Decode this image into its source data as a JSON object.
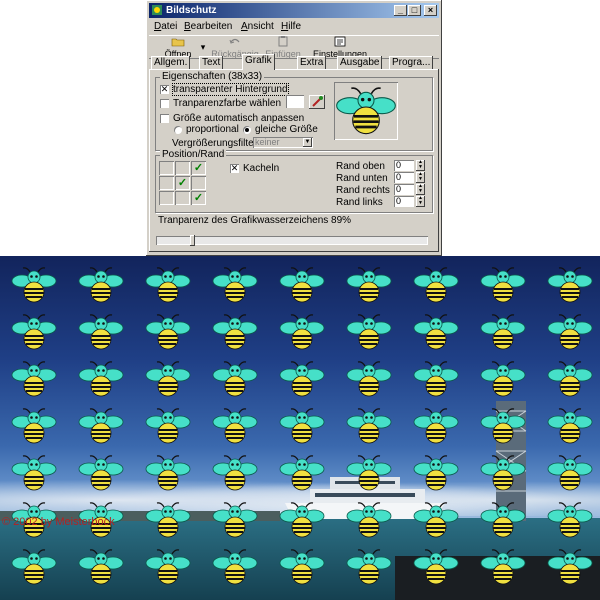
{
  "window": {
    "title": "Bildschutz",
    "min": "_",
    "max": "□",
    "close": "×"
  },
  "menu": [
    "Datei",
    "Bearbeiten",
    "Ansicht",
    "Hilfe"
  ],
  "toolbar": {
    "open": "Öffnen",
    "undo": "Rückgängig",
    "paste": "Einfügen",
    "settings": "Einstellungen"
  },
  "tabs": [
    "Allgem.",
    "Text",
    "Grafik",
    "Extra",
    "Ausgabe",
    "Progra..."
  ],
  "active_tab": "Grafik",
  "properties": {
    "legend": "Eigenschaften (38x33)",
    "transparent_bg": "transparenter Hintergrund",
    "transparent_bg_checked": true,
    "choose_color": "Tranparenzfarbe wählen",
    "auto_size": "Größe automatisch anpassen",
    "proportional": "proportional",
    "same_size": "gleiche Größe",
    "zoom_filter_label": "Vergrößerungsfilter",
    "zoom_filter_value": "keiner"
  },
  "position": {
    "legend": "Position/Rand",
    "tile": "Kacheln",
    "tile_checked": true,
    "grid_checks": [
      false,
      false,
      true,
      false,
      true,
      false,
      false,
      true,
      false
    ],
    "margins": [
      {
        "label": "Rand oben",
        "value": "0"
      },
      {
        "label": "Rand unten",
        "value": "0"
      },
      {
        "label": "Rand rechts",
        "value": "0"
      },
      {
        "label": "Rand links",
        "value": "0"
      }
    ]
  },
  "transparency_label": "Tranparenz des Grafikwasserzeichens 89%",
  "transparency_percent": 89,
  "watermark": "© 2002 by Meisterbock",
  "colors": {
    "bee_green": "#46e0c8",
    "bee_yellow": "#f0e040",
    "title_start": "#0a246a",
    "title_end": "#a6caf0"
  }
}
